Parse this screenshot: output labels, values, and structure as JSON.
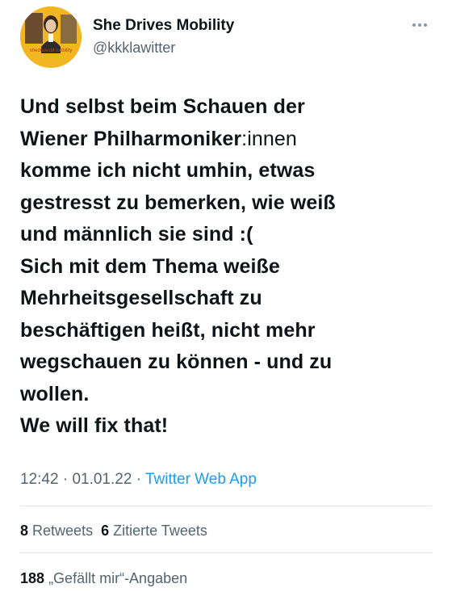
{
  "user": {
    "display_name": "She Drives Mobility",
    "handle": "@kkklawitter",
    "avatar_brand": "shedrivesM  mobility"
  },
  "tweet": {
    "line1": "Und selbst beim Schauen der",
    "line2_bold": "Wiener Philharmoniker",
    "line2_plain": ":innen",
    "line3": "komme ich nicht umhin, etwas",
    "line4": "gestresst zu bemerken, wie weiß",
    "line5": "und männlich sie sind :(",
    "line6": "Sich mit dem Thema weiße",
    "line7": "Mehrheitsgesellschaft zu",
    "line8": "beschäftigen heißt, nicht mehr",
    "line9": "wegschauen zu können - und zu",
    "line10": "wollen.",
    "line11": "We will fix that!"
  },
  "meta": {
    "time": "12:42",
    "sep1": " · ",
    "date": "01.01.22",
    "sep2": " · ",
    "app": "Twitter Web App"
  },
  "stats": {
    "retweets_count": "8",
    "retweets_label": "Retweets",
    "quotes_count": "6",
    "quotes_label": "Zitierte Tweets",
    "likes_count": "188",
    "likes_label": "„Gefällt mir“-Angaben"
  },
  "colors": {
    "link": "#1d9bf0",
    "secondary": "#536471",
    "text": "#0f1419",
    "avatar_bg": "#f2b623"
  }
}
